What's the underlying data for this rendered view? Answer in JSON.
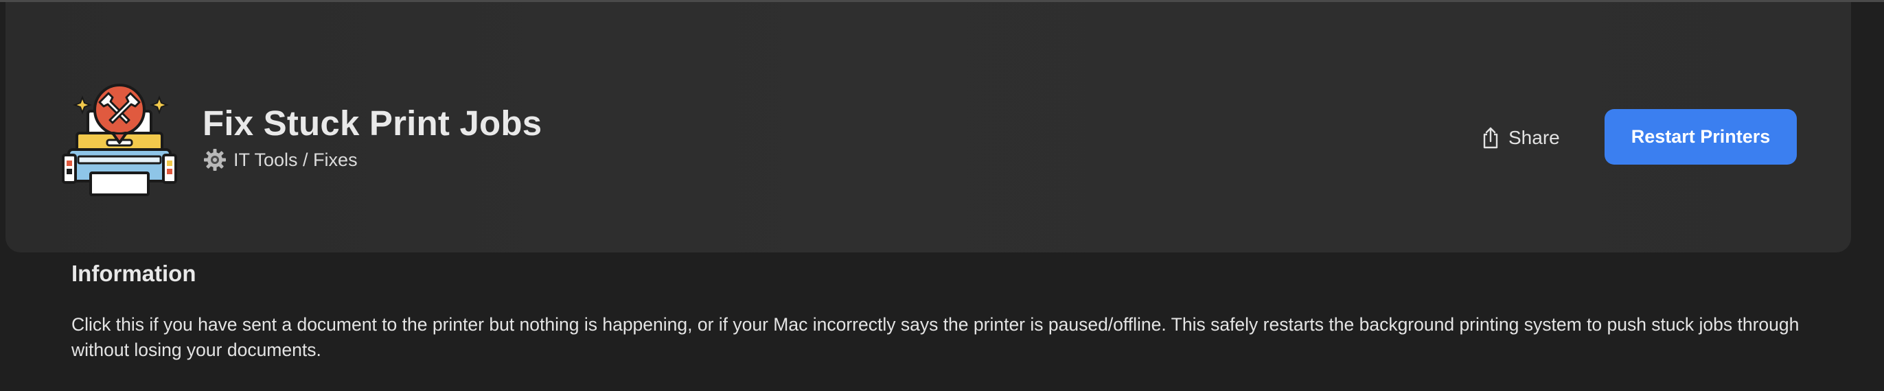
{
  "header": {
    "title": "Fix Stuck Print Jobs",
    "category": "IT Tools / Fixes",
    "category_icon": "gear-icon",
    "app_icon": "printer-repair-icon",
    "share_label": "Share",
    "share_icon": "share-icon",
    "primary_action_label": "Restart Printers"
  },
  "info": {
    "heading": "Information",
    "description": "Click this if you have sent a document to the printer but nothing is happening, or if your Mac incorrectly says the printer is paused/offline. This safely restarts the background printing system to push stuck jobs through without losing your documents."
  },
  "colors": {
    "background": "#1f1f1f",
    "header_card": "#2d2d2d",
    "accent": "#3b7ff0",
    "text": "#e6e6e6"
  }
}
